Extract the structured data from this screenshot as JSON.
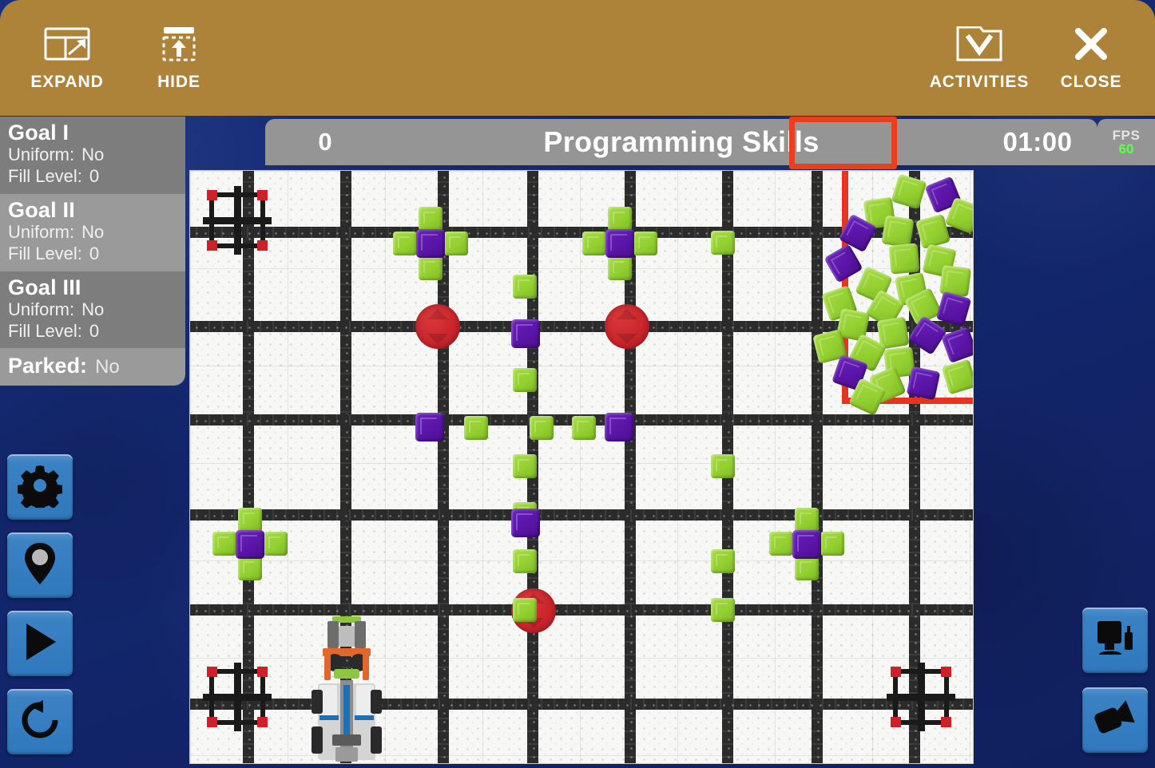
{
  "toolbar": {
    "buttons": [
      {
        "label": "EXPAND",
        "icon": "expand-window-icon"
      },
      {
        "label": "HIDE",
        "icon": "hide-panel-icon"
      },
      {
        "label": "ACTIVITIES",
        "icon": "activities-folder-icon"
      },
      {
        "label": "CLOSE",
        "icon": "close-x-icon"
      }
    ],
    "background_color": "#AD8239",
    "label_color": "#FFFFFF"
  },
  "header": {
    "score": "0",
    "title": "Programming Skills",
    "timer": "01:00",
    "timer_highlighted": true,
    "highlight_color": "#E8401F",
    "bar_color": "#959595"
  },
  "fps": {
    "label": "FPS",
    "value": "60",
    "value_color": "#5DFF4E"
  },
  "goals_panel": {
    "goals": [
      {
        "name": "Goal I",
        "uniform_label": "Uniform:",
        "uniform_value": "No",
        "fill_label": "Fill Level:",
        "fill_value": "0"
      },
      {
        "name": "Goal II",
        "uniform_label": "Uniform:",
        "uniform_value": "No",
        "fill_label": "Fill Level:",
        "fill_value": "0"
      },
      {
        "name": "Goal III",
        "uniform_label": "Uniform:",
        "uniform_value": "No",
        "fill_label": "Fill Level:",
        "fill_value": "0"
      }
    ],
    "parked_label": "Parked:",
    "parked_value": "No"
  },
  "left_controls": [
    {
      "name": "settings-button",
      "icon": "gear-icon"
    },
    {
      "name": "waypoint-button",
      "icon": "location-pin-icon"
    },
    {
      "name": "play-button",
      "icon": "play-icon"
    },
    {
      "name": "reset-button",
      "icon": "reload-icon"
    }
  ],
  "right_controls": [
    {
      "name": "display-view-button",
      "icon": "monitor-icon"
    },
    {
      "name": "camera-view-button",
      "icon": "camera-icon"
    }
  ],
  "field": {
    "background_color": "#F7F7F6",
    "grid_color": "#2F2F2F",
    "cube_green_color": "#93D030",
    "cube_purple_color": "#5B14A8",
    "disc_color": "#C9252B",
    "loading_zone_line_color": "#E8331F",
    "goal_structures": 3,
    "robot_present": true,
    "robot_label": "ev3-robot"
  },
  "colors": {
    "felt_background": "#152C7A",
    "panel_gray_dark": "#7D7D7D",
    "panel_gray_light": "#9A9A9A",
    "control_blue": "#3B82C4"
  }
}
